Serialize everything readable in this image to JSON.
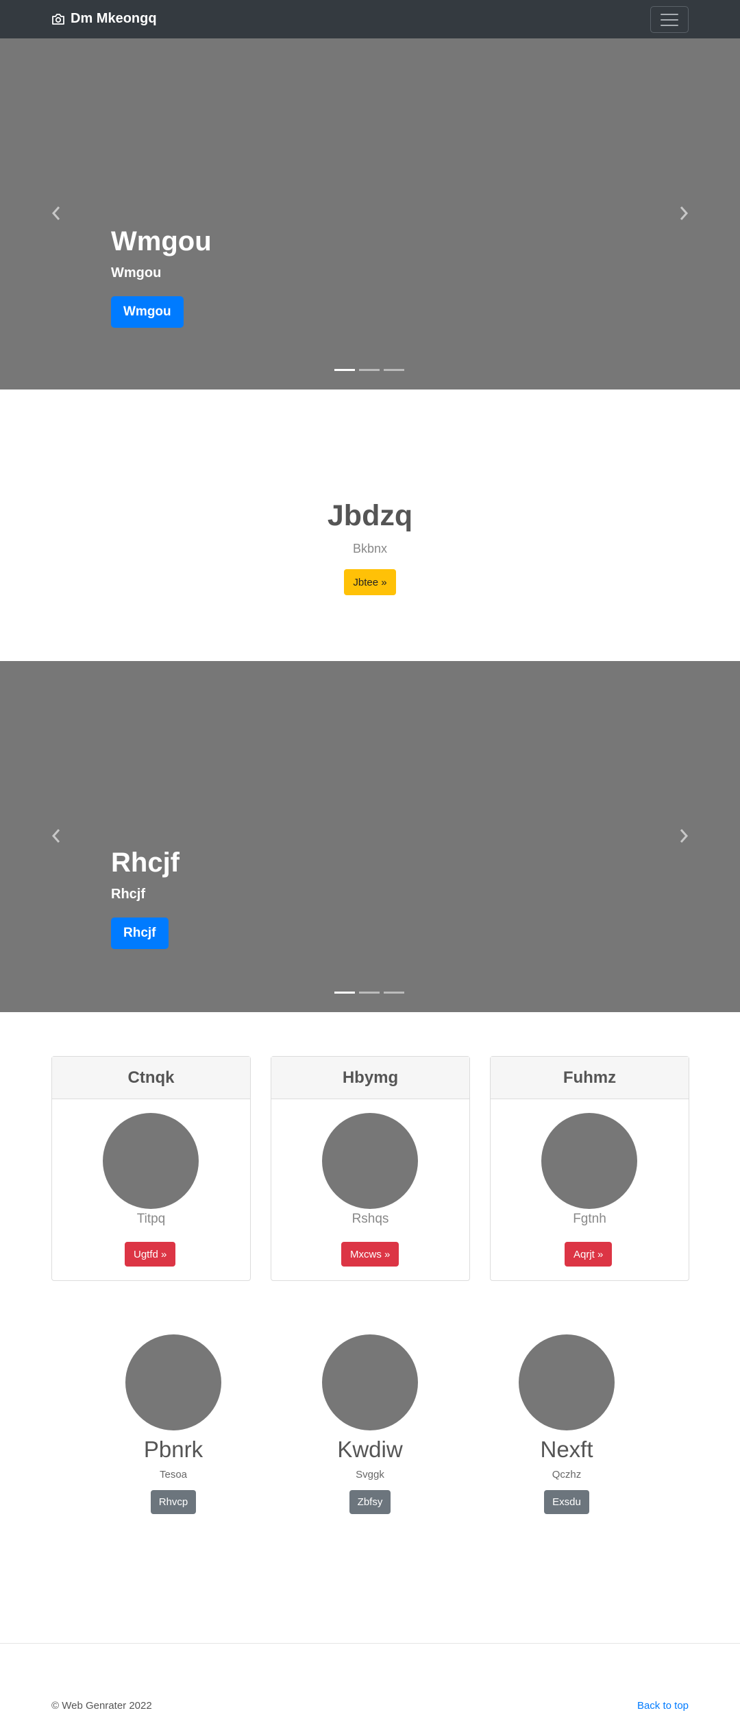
{
  "navbar": {
    "brand": "Dm Mkeongq",
    "brand_icon": "camera-icon",
    "toggler_icon": "hamburger-menu-icon"
  },
  "carousel1": {
    "title": "Wmgou",
    "subtitle": "Wmgou",
    "button": "Wmgou",
    "slides": 3,
    "active_slide": 1
  },
  "hero": {
    "title": "Jbdzq",
    "text": "Bkbnx",
    "button": "Jbtee »"
  },
  "carousel2": {
    "title": "Rhcjf",
    "subtitle": "Rhcjf",
    "button": "Rhcjf",
    "slides": 3,
    "active_slide": 1
  },
  "cards": [
    {
      "header": "Ctnqk",
      "text": "Titpq",
      "button": "Ugtfd »"
    },
    {
      "header": "Hbymg",
      "text": "Rshqs",
      "button": "Mxcws »"
    },
    {
      "header": "Fuhmz",
      "text": "Fgtnh",
      "button": "Aqrjt »"
    }
  ],
  "features": [
    {
      "title": "Pbnrk",
      "text": "Tesoa",
      "button": "Rhvcp"
    },
    {
      "title": "Kwdiw",
      "text": "Svggk",
      "button": "Zbfsy"
    },
    {
      "title": "Nexft",
      "text": "Qczhz",
      "button": "Exsdu"
    }
  ],
  "footer": {
    "copyright": "© Web Genrater 2022",
    "back_to_top": "Back to top"
  },
  "colors": {
    "navbar": "#343a40",
    "placeholder": "#777777",
    "primary": "#007bff",
    "warning": "#ffc107",
    "danger": "#dc3545",
    "secondary": "#6c757d"
  }
}
